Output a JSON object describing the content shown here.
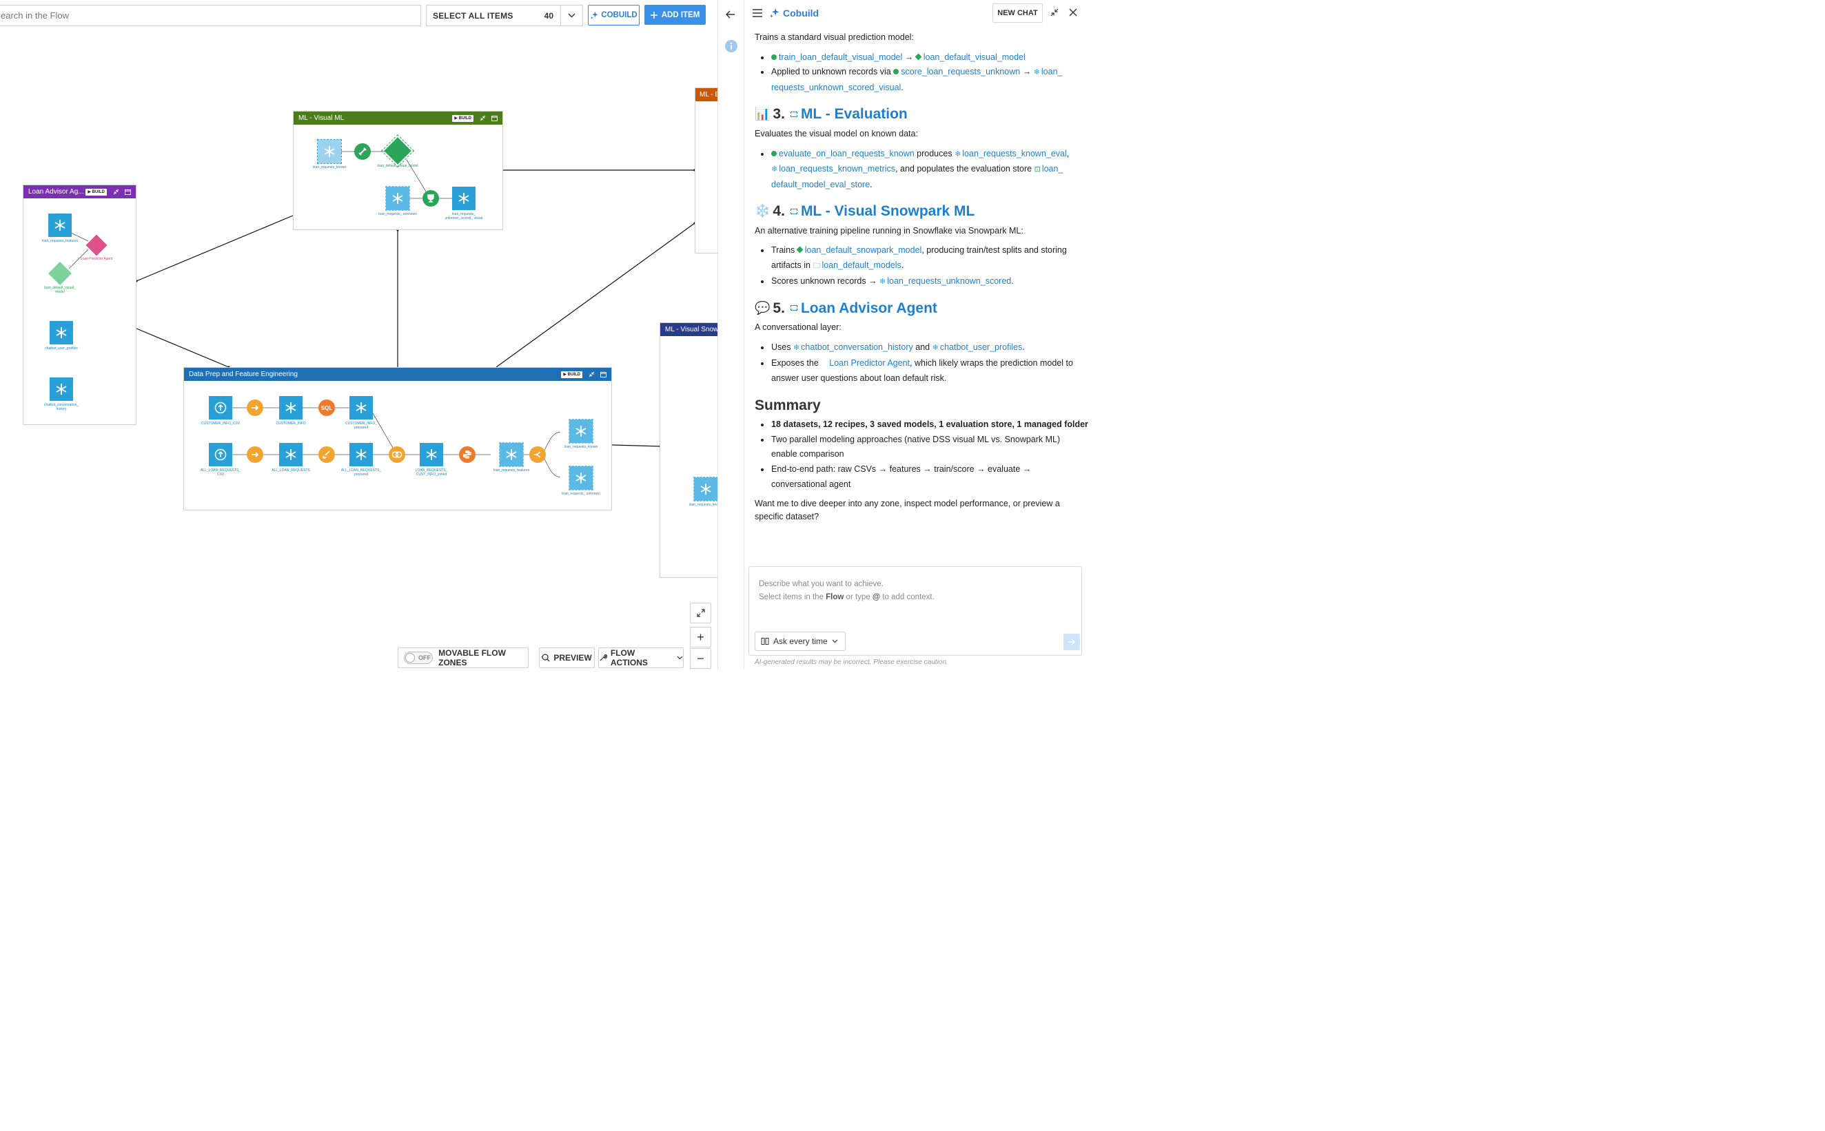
{
  "toolbar": {
    "search_placeholder": "earch in the Flow",
    "select_all_label": "SELECT ALL ITEMS",
    "select_count": "40",
    "cobuild_label": "COBUILD",
    "add_item_label": "ADD ITEM"
  },
  "zones": {
    "visual_ml": {
      "title": "ML - Visual ML",
      "color": "#4d7c1c",
      "build": "BUILD",
      "nodes": {
        "loan_requests_known": "loan_requests_known",
        "loan_default_visual_model": "loan_default_visual_model",
        "loan_requests_unknown": "loan_requests_ unknown",
        "loan_requests_unknown_scored_visual": "loan_requests_ unknown_scored_ visual"
      }
    },
    "loan_advisor": {
      "title": "Loan Advisor Ag...",
      "color": "#7b2fb3",
      "build": "BUILD",
      "nodes": {
        "loan_requests_features": "loan_requests_features",
        "loan_predictor_agent": "Loan Predictor Agent",
        "loan_default_visual_model": "loan_default_visual_ model",
        "chatbot_user_profiles": "chatbot_user_profiles",
        "chatbot_conversation_history": "chatbot_conversation_ history"
      }
    },
    "data_prep": {
      "title": "Data Prep and Feature Engineering",
      "color": "#1f6fb5",
      "build": "BUILD",
      "nodes": {
        "customer_info_csv": "CUSTOMER_INFO_CSV",
        "customer_info": "CUSTOMER_INFO",
        "customer_info_prepared": "CUSTOMER_INFO_ prepared",
        "all_loan_requests_csv": "ALL_LOAN_REQUESTS_ CSV",
        "all_loan_requests": "ALL_LOAN_REQUESTS",
        "all_loan_requests_prepared": "ALL_LOAN_REQUESTS_ prepared",
        "loan_requests_cust_info_joined": "LOAN_REQUESTS_ CUST_INFO_joined",
        "loan_requests_features": "loan_requests_features",
        "loan_requests_known": "loan_requests_known",
        "loan_requests_unknown": "loan_requests_ unknown",
        "sql_label": "SQL"
      }
    },
    "ml_eval": {
      "title": "ML - E",
      "color": "#c75a0a"
    },
    "ml_snow": {
      "title": "ML - Visual Snowp",
      "color": "#283c8c",
      "nodes": {
        "loan_requests_known": "loan_requests_known"
      }
    }
  },
  "canvas_controls": {
    "toggle_state": "OFF",
    "movable_label": "MOVABLE FLOW ZONES",
    "preview_label": "PREVIEW",
    "flow_actions_label": "FLOW ACTIONS",
    "zoom_in": "+",
    "zoom_out": "−"
  },
  "chat": {
    "title": "Cobuild",
    "new_chat": "NEW CHAT",
    "intro": "Trains a standard visual prediction model:",
    "s2": {
      "b1_a": "train_loan_default_visual_model",
      "b1_arrow": " → ",
      "b1_b": "loan_default_visual_model",
      "b2_text": "Applied to unknown records via ",
      "b2_a": "score_loan_requests_unknown",
      "b2_arrow": " → ",
      "b2_b": "loan_ requests_unknown_scored_visual",
      "b2_end": "."
    },
    "s3": {
      "emoji": "📊",
      "num": "3.",
      "title": "ML - Evaluation",
      "desc": "Evaluates the visual model on known data:",
      "b1_a": "evaluate_on_loan_requests_known",
      "b1_t1": " produces ",
      "b1_b": "loan_requests_known_eval",
      "b1_t2": ",",
      "b1_c": "loan_requests_known_metrics",
      "b1_t3": ", and populates the evaluation store ",
      "b1_d": "loan_ default_model_eval_store",
      "b1_end": "."
    },
    "s4": {
      "emoji": "❄️",
      "num": "4.",
      "title": "ML - Visual Snowpark ML",
      "desc": "An alternative training pipeline running in Snowflake via Snowpark ML:",
      "b1_t1": "Trains ",
      "b1_a": "loan_default_snowpark_model",
      "b1_t2": ", producing train/test splits and storing artifacts in ",
      "b1_b": "loan_default_models",
      "b1_end": ".",
      "b2_t1": "Scores unknown records → ",
      "b2_a": "loan_requests_unknown_scored",
      "b2_end": "."
    },
    "s5": {
      "emoji": "💬",
      "num": "5.",
      "title": "Loan Advisor Agent",
      "desc": "A conversational layer:",
      "b1_t1": "Uses ",
      "b1_a": "chatbot_conversation_history",
      "b1_t2": " and ",
      "b1_b": "chatbot_user_profiles",
      "b1_end": ".",
      "b2_t1": "Exposes the ",
      "b2_a": "Loan Predictor Agent",
      "b2_t2": ", which likely wraps the prediction model to answer user questions about loan default risk."
    },
    "summary": {
      "title": "Summary",
      "b1": "18 datasets, 12 recipes, 3 saved models, 1 evaluation store, 1 managed folder",
      "b2": "Two parallel modeling approaches (native DSS visual ML vs. Snowpark ML) enable comparison",
      "b3": "End-to-end path: raw CSVs → features → train/score → evaluate → conversational agent"
    },
    "closing": "Want me to dive deeper into any zone, inspect model performance, or preview a specific dataset?",
    "composer": {
      "line1": "Describe what you want to achieve.",
      "line2_a": "Select items in the ",
      "line2_b": "Flow",
      "line2_c": " or type ",
      "line2_d": "@",
      "line2_e": " to add context."
    },
    "ask_mode": "Ask every time",
    "disclaimer": "AI-generated results may be incorrect. Please exercise caution."
  }
}
